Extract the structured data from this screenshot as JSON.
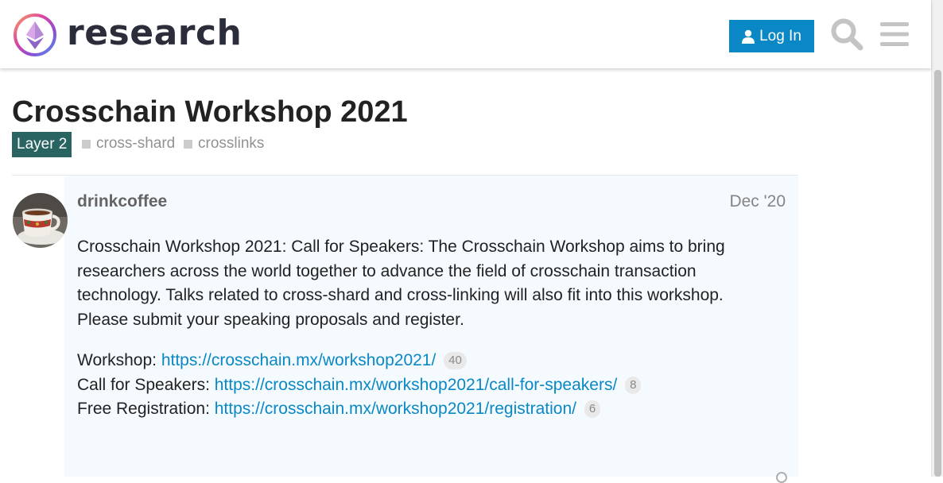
{
  "header": {
    "logo_text": "research",
    "login_label": "Log In"
  },
  "topic": {
    "title": "Crosschain Workshop 2021",
    "category": "Layer 2",
    "tags": [
      "cross-shard",
      "crosslinks"
    ]
  },
  "post": {
    "username": "drinkcoffee",
    "date": "Dec '20",
    "body": "Crosschain Workshop 2021: Call for Speakers: The Crosschain Workshop aims to bring researchers across the world together to advance the field of crosschain transaction technology. Talks related to cross-shard and cross-linking will also fit into this workshop. Please submit your speaking proposals and register.",
    "links": [
      {
        "label": "Workshop: ",
        "url": "https://crosschain.mx/workshop2021/",
        "clicks": "40"
      },
      {
        "label": "Call for Speakers: ",
        "url": "https://crosschain.mx/workshop2021/call-for-speakers/",
        "clicks": "8"
      },
      {
        "label": "Free Registration: ",
        "url": "https://crosschain.mx/workshop2021/registration/",
        "clicks": "6"
      }
    ]
  },
  "icons": {
    "logo": "ethereum-research-logo-icon",
    "login": "user-icon",
    "search": "search-icon",
    "menu": "hamburger-menu-icon"
  },
  "colors": {
    "accent": "#0a88c6",
    "category": "#2a6462",
    "post_background": "#f4fafe"
  }
}
